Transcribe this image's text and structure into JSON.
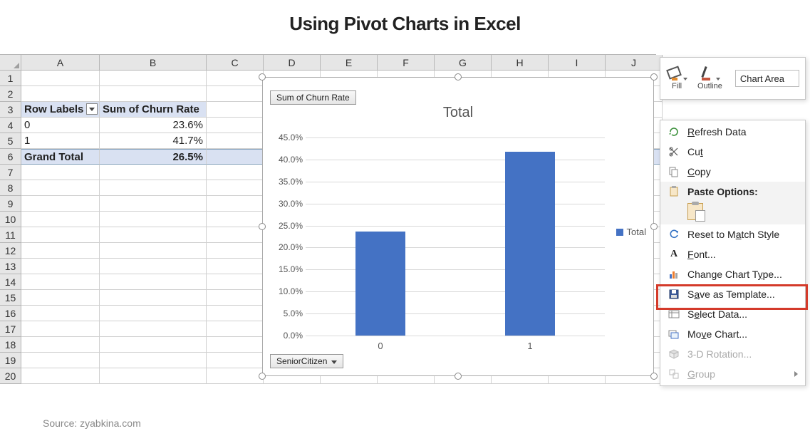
{
  "page_title": "Using Pivot Charts in Excel",
  "source_text": "Source: zyabkina.com",
  "columns": [
    "A",
    "B",
    "C",
    "D",
    "E",
    "F",
    "G",
    "H",
    "I",
    "J"
  ],
  "row_count": 20,
  "col_widths": {
    "A": 110,
    "B": 150
  },
  "pivot": {
    "header_row": 3,
    "row_labels_hdr": "Row Labels",
    "value_hdr": "Sum of Churn Rate",
    "rows": [
      {
        "label": "0",
        "value": "23.6%"
      },
      {
        "label": "1",
        "value": "41.7%"
      }
    ],
    "grand_label": "Grand Total",
    "grand_value": "26.5%"
  },
  "chart_data": {
    "type": "bar",
    "title": "Total",
    "categories": [
      "0",
      "1"
    ],
    "values": [
      0.236,
      0.417
    ],
    "ylabel": "",
    "xlabel": "",
    "ylim": [
      0,
      0.45
    ],
    "yticks": [
      "0.0%",
      "5.0%",
      "10.0%",
      "15.0%",
      "20.0%",
      "25.0%",
      "30.0%",
      "35.0%",
      "40.0%",
      "45.0%"
    ],
    "legend": "Total",
    "value_field_button": "Sum of Churn Rate",
    "category_field_button": "SeniorCitizen"
  },
  "mini_toolbar": {
    "fill": "Fill",
    "outline": "Outline",
    "selector": "Chart Area"
  },
  "context_menu": {
    "refresh": "Refresh Data",
    "cut": "Cut",
    "copy": "Copy",
    "paste_options": "Paste Options:",
    "reset": "Reset to Match Style",
    "font": "Font...",
    "change_type": "Change Chart Type...",
    "save_template": "Save as Template...",
    "select_data": "Select Data...",
    "move_chart": "Move Chart...",
    "rotation": "3-D Rotation...",
    "group": "Group"
  }
}
